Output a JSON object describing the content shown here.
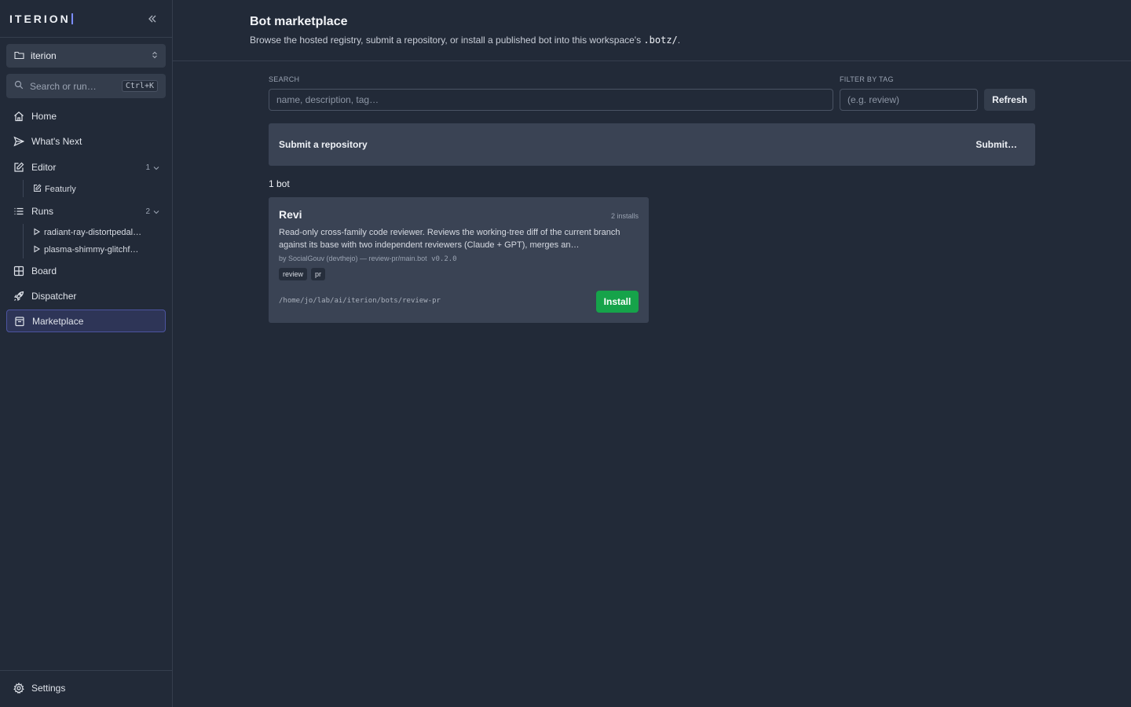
{
  "app": {
    "brand": "ITERION"
  },
  "sidebar": {
    "workspace": "iterion",
    "search": {
      "placeholder": "Search or run…",
      "shortcut": "Ctrl+K"
    },
    "nav": {
      "home": "Home",
      "whats_next": "What's Next",
      "editor": {
        "label": "Editor",
        "count": "1",
        "children": [
          "Featurly"
        ]
      },
      "runs": {
        "label": "Runs",
        "count": "2",
        "children": [
          "radiant-ray-distortpedal…",
          "plasma-shimmy-glitchf…"
        ]
      },
      "board": "Board",
      "dispatcher": "Dispatcher",
      "marketplace": "Marketplace"
    },
    "settings": "Settings",
    "active_item": "Marketplace"
  },
  "header": {
    "title": "Bot marketplace",
    "subtitle_pre": "Browse the hosted registry, submit a repository, or install a published bot into this workspace's ",
    "subtitle_code": ".botz/",
    "subtitle_post": "."
  },
  "filters": {
    "search_label": "SEARCH",
    "search_placeholder": "name, description, tag…",
    "tag_label": "FILTER BY TAG",
    "tag_placeholder": "(e.g. review)",
    "refresh": "Refresh"
  },
  "submit": {
    "title": "Submit a repository",
    "action": "Submit…"
  },
  "results": {
    "count_label": "1 bot"
  },
  "bots": [
    {
      "name": "Revi",
      "installs": "2 installs",
      "description": "Read-only cross-family code reviewer. Reviews the working-tree diff of the current branch against its base with two independent reviewers (Claude + GPT), merges an…",
      "meta": "by SocialGouv (devthejo) — review-pr/main.bot",
      "version": "v0.2.0",
      "tags": [
        "review",
        "pr"
      ],
      "path": "/home/jo/lab/ai/iterion/bots/review-pr",
      "install": "Install"
    }
  ],
  "colors": {
    "accent": "#7b8cff",
    "install": "#16a34a",
    "background": "#222a38",
    "panel": "#3a4354"
  }
}
